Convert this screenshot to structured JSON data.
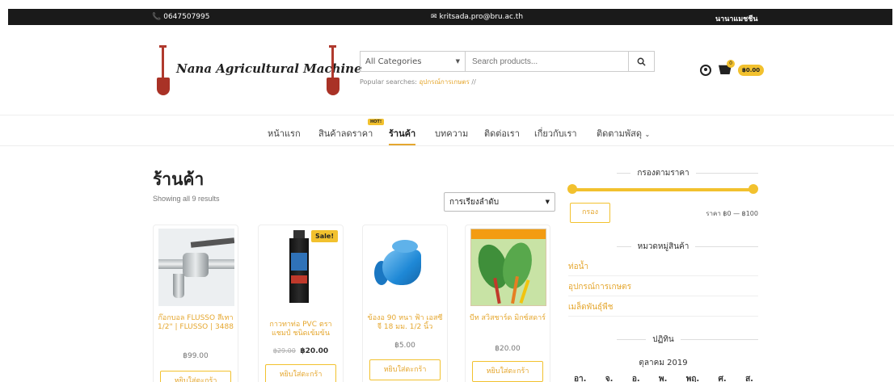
{
  "topbar": {
    "phone": "0647507995",
    "email": "kritsada.pro@bru.ac.th",
    "user": "นานาแมชชีน"
  },
  "header": {
    "logo_text": "Nana Agricultural Machine",
    "search": {
      "category": "All Categories",
      "placeholder": "Search products...",
      "popular_label": "Popular searches:",
      "popular_link": "อุปกรณ์การเกษตร",
      "popular_sep": "//"
    },
    "cart": {
      "count": "0",
      "total": "฿0.00"
    }
  },
  "nav": {
    "hot_badge": "HOT!",
    "items": [
      "หน้าแรก",
      "สินค้าลดราคา",
      "ร้านค้า",
      "บทความ",
      "ติดต่อเรา",
      "เกี่ยวกับเรา",
      "ติดตามพัสดุ"
    ],
    "active_index": 2
  },
  "shop": {
    "title": "ร้านค้า",
    "results": "Showing all 9 results",
    "sort_label": "การเรียงลำดับ",
    "add_to_cart": "หยิบใส่ตะกร้า",
    "sale_badge": "Sale!",
    "products": [
      {
        "name": "ก๊อกบอล FLUSSO สีเทา 1/2\" | FLUSSO | 3488",
        "price": "฿99.00",
        "old_price": ""
      },
      {
        "name": "กาวทาท่อ PVC ตราแชมป์ ชนิดเข้มข้น",
        "price": "฿20.00",
        "old_price": "฿29.00"
      },
      {
        "name": "ข้องอ 90 หนา ฟ้า เอสซีจี 18 มม. 1/2 นิ้ว",
        "price": "฿5.00",
        "old_price": ""
      },
      {
        "name": "บีท สวิสชาร์ด มิกซ์สดาร์",
        "price": "฿20.00",
        "old_price": ""
      }
    ]
  },
  "sidebar": {
    "price_filter_title": "กรองตามราคา",
    "filter_button": "กรอง",
    "price_range": "ราคา ฿0 — ฿100",
    "categories_title": "หมวดหมู่สินค้า",
    "categories": [
      "ท่อน้ำ",
      "อุปกรณ์การเกษตร",
      "เมล็ดพันธุ์พืช"
    ],
    "calendar_title": "ปฏิทิน",
    "calendar_month": "ตุลาคม 2019",
    "calendar_days": [
      "อา.",
      "จ.",
      "อ.",
      "พ.",
      "พฤ.",
      "ศ.",
      "ส."
    ]
  }
}
